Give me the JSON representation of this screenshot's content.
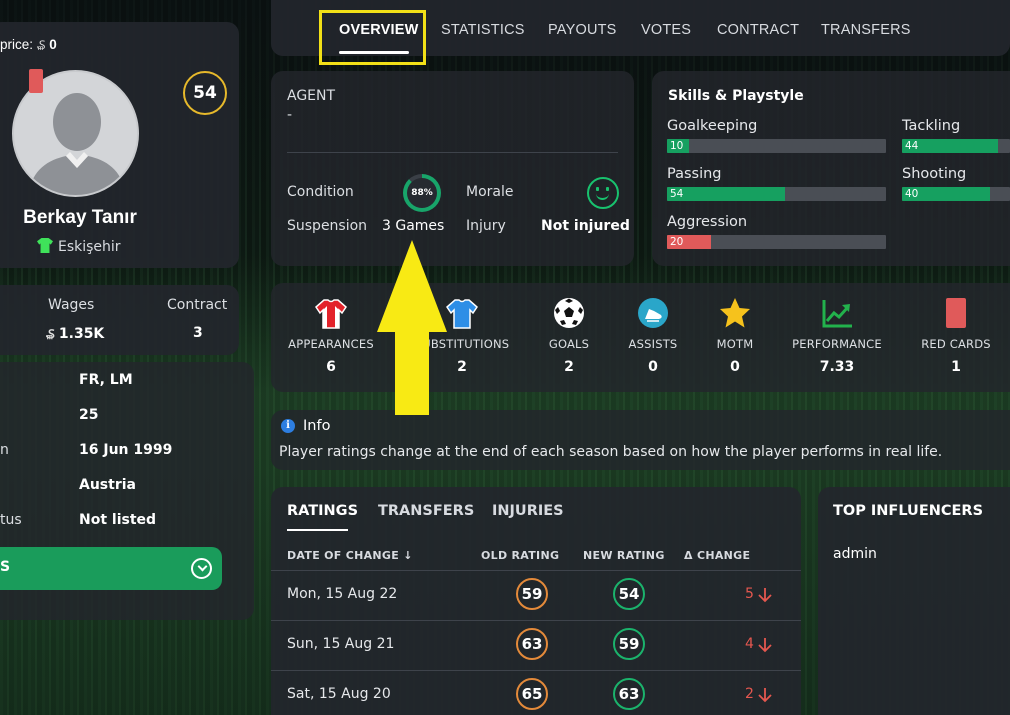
{
  "tabs": [
    "OVERVIEW",
    "STATISTICS",
    "PAYOUTS",
    "VOTES",
    "CONTRACT",
    "TRANSFERS"
  ],
  "player": {
    "price_label": "price:",
    "price_value": "0",
    "rating": "54",
    "name": "Berkay Tanır",
    "club": "Eskişehir"
  },
  "contract_summary": {
    "wages_label": "Wages",
    "wages_value": "1.35K",
    "contract_label": "Contract",
    "contract_value": "3"
  },
  "details": {
    "row1_label": "",
    "row1_value": "FR, LM",
    "row2_value": "25",
    "row3_label": "n",
    "row3_value": "16 Jun 1999",
    "row4_value": "Austria",
    "row5_label": "tus",
    "row5_value": "Not listed",
    "button_label": "S"
  },
  "agent": {
    "agent_label": "AGENT",
    "agent_value": "-",
    "condition_label": "Condition",
    "condition_value": "88%",
    "morale_label": "Morale",
    "suspension_label": "Suspension",
    "suspension_value": "3 Games",
    "injury_label": "Injury",
    "injury_value": "Not injured"
  },
  "skills": {
    "title": "Skills & Playstyle",
    "items": [
      {
        "label": "Goalkeeping",
        "value": "10",
        "level": 10,
        "color": "#16a060"
      },
      {
        "label": "Tackling",
        "value": "44",
        "level": 44,
        "color": "#16a060"
      },
      {
        "label": "Passing",
        "value": "54",
        "level": 54,
        "color": "#16a060"
      },
      {
        "label": "Shooting",
        "value": "40",
        "level": 40,
        "color": "#16a060"
      },
      {
        "label": "Aggression",
        "value": "20",
        "level": 20,
        "color": "#e05a5a"
      }
    ]
  },
  "stats": [
    {
      "label": "APPEARANCES",
      "value": "6",
      "icon": "red-shirt-icon"
    },
    {
      "label": "SUBSTITUTIONS",
      "value": "2",
      "icon": "blue-shirt-icon"
    },
    {
      "label": "GOALS",
      "value": "2",
      "icon": "football-icon"
    },
    {
      "label": "ASSISTS",
      "value": "0",
      "icon": "boot-icon"
    },
    {
      "label": "MOTM",
      "value": "0",
      "icon": "star-icon"
    },
    {
      "label": "PERFORMANCE",
      "value": "7.33",
      "icon": "trend-chart-icon"
    },
    {
      "label": "RED CARDS",
      "value": "1",
      "icon": "red-card-icon"
    }
  ],
  "info": {
    "title": "Info",
    "text": "Player ratings change at the end of each season based on how the player performs in real life."
  },
  "ratings": {
    "tabs": [
      "RATINGS",
      "TRANSFERS",
      "INJURIES"
    ],
    "headers": [
      "DATE OF CHANGE",
      "OLD RATING",
      "NEW RATING",
      "Δ CHANGE"
    ],
    "rows": [
      {
        "date": "Mon, 15 Aug 22",
        "old": "59",
        "new": "54",
        "change": "5"
      },
      {
        "date": "Sun, 15 Aug 21",
        "old": "63",
        "new": "59",
        "change": "4"
      },
      {
        "date": "Sat, 15 Aug 20",
        "old": "65",
        "new": "63",
        "change": "2"
      }
    ]
  },
  "influencers": {
    "title": "TOP INFLUENCERS",
    "items": [
      "admin"
    ]
  },
  "colors": {
    "accent_green": "#1a9c5b",
    "rating_badge": "#e7b92b",
    "annotation_yellow": "#f8ea14",
    "negative_red": "#e5574f"
  }
}
